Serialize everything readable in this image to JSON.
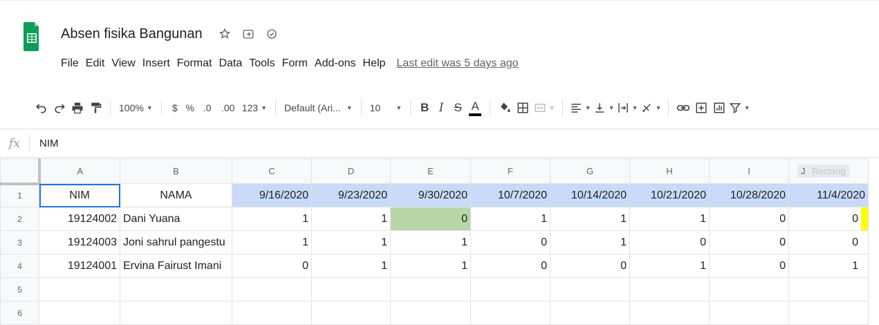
{
  "doc": {
    "title": "Absen fisika Bangunan",
    "last_edit": "Last edit was 5 days ago"
  },
  "menu": [
    "File",
    "Edit",
    "View",
    "Insert",
    "Format",
    "Data",
    "Tools",
    "Form",
    "Add-ons",
    "Help"
  ],
  "toolbar": {
    "zoom": "100%",
    "currency": "$",
    "percent": "%",
    "dec_decrease": ".0",
    "dec_increase": ".00",
    "more_formats": "123",
    "font": "Default (Ari...",
    "font_size": "10",
    "bold": "B",
    "italic": "I",
    "strike": "S",
    "text_color": "A"
  },
  "formula_bar": {
    "fx": "fx",
    "value": "NIM"
  },
  "sheet": {
    "col_headers": [
      "A",
      "B",
      "C",
      "D",
      "E",
      "F",
      "G",
      "H",
      "I",
      "J"
    ],
    "j_overlay": "Rectang",
    "row_headers": [
      "1",
      "2",
      "3",
      "4",
      "5",
      "6"
    ],
    "header_row": [
      "NIM",
      "NAMA",
      "9/16/2020",
      "9/23/2020",
      "9/30/2020",
      "10/7/2020",
      "10/14/2020",
      "10/21/2020",
      "10/28/2020",
      "11/4/2020"
    ],
    "rows": [
      [
        "19124002",
        "Dani Yuana",
        "1",
        "1",
        "0",
        "1",
        "1",
        "1",
        "0",
        "0"
      ],
      [
        "19124003",
        "Joni sahrul pangestu",
        "1",
        "1",
        "1",
        "0",
        "1",
        "0",
        "0",
        "0"
      ],
      [
        "19124001",
        "Ervina Fairust Imani",
        "0",
        "1",
        "1",
        "0",
        "0",
        "1",
        "0",
        "1"
      ]
    ]
  },
  "colors": {
    "date_header": "#c9daf8",
    "highlight_green": "#b7d7a8",
    "highlight_yellow": "#ffff00",
    "sheets_green": "#0f9d58"
  }
}
